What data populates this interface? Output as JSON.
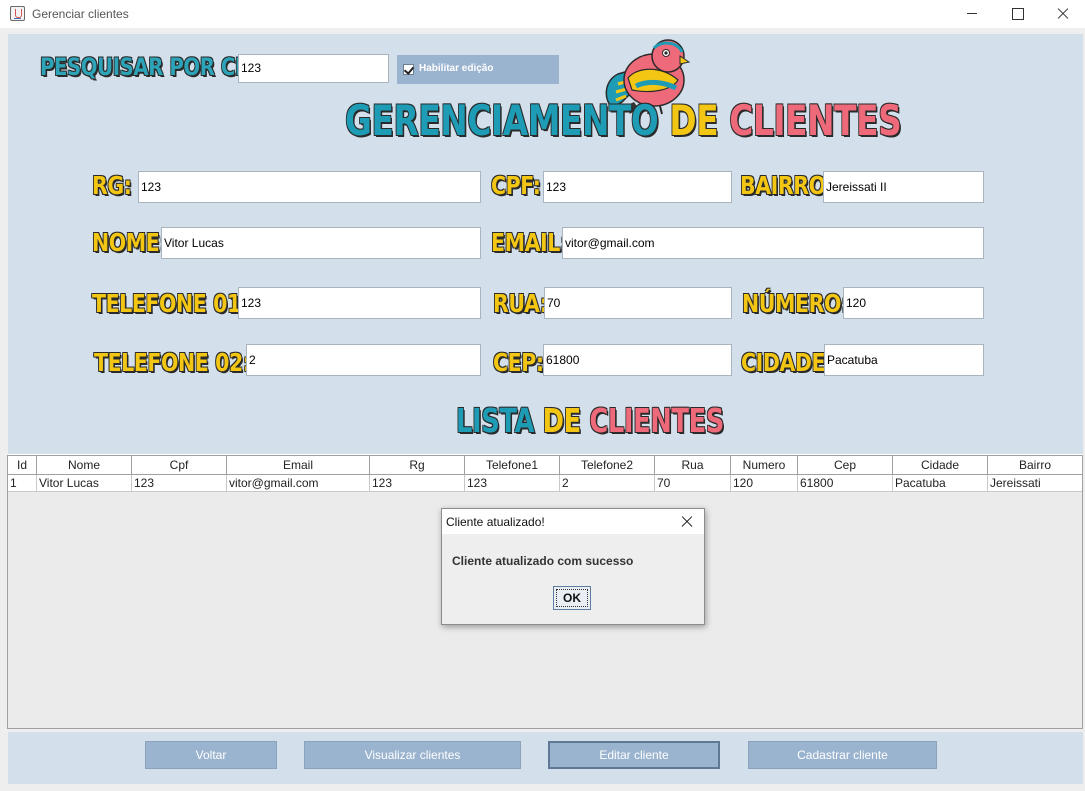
{
  "window": {
    "title": "Gerenciar clientes"
  },
  "search": {
    "label": "PESQUISAR POR CPF:",
    "value": "123",
    "edit_toggle_label": "Habilitar edição",
    "edit_toggle_checked": true
  },
  "header": {
    "title_part1": "GERENCIAMENTO ",
    "title_part2": "DE ",
    "title_part3": "CLIENTES"
  },
  "form": {
    "rg": {
      "label": "RG:",
      "value": "123"
    },
    "cpf": {
      "label": "CPF:",
      "value": "123"
    },
    "bairro": {
      "label": "BAIRRO:",
      "value": "Jereissati II"
    },
    "nome": {
      "label": "NOME:",
      "value": "Vitor Lucas"
    },
    "email": {
      "label": "EMAIL:",
      "value": "vitor@gmail.com"
    },
    "telefone1": {
      "label": "TELEFONE 01:",
      "value": "123"
    },
    "rua": {
      "label": "RUA:",
      "value": "70"
    },
    "numero": {
      "label": "NÚMERO:",
      "value": "120"
    },
    "telefone2": {
      "label": "TELEFONE 02:",
      "value": "2"
    },
    "cep": {
      "label": "CEP:",
      "value": "61800"
    },
    "cidade": {
      "label": "CIDADE:",
      "value": "Pacatuba"
    }
  },
  "list": {
    "title_part1": "LISTA ",
    "title_part2": "DE ",
    "title_part3": "CLIENTES"
  },
  "table": {
    "columns": [
      "Id",
      "Nome",
      "Cpf",
      "Email",
      "Rg",
      "Telefone1",
      "Telefone2",
      "Rua",
      "Numero",
      "Cep",
      "Cidade",
      "Bairro"
    ],
    "rows": [
      [
        "1",
        "Vitor Lucas",
        "123",
        "vitor@gmail.com",
        "123",
        "123",
        "2",
        "70",
        "120",
        "61800",
        "Pacatuba",
        "Jereissati"
      ]
    ]
  },
  "dialog": {
    "title": "Cliente atualizado!",
    "message": "Cliente atualizado com sucesso",
    "ok_label": "OK"
  },
  "buttons": {
    "voltar": "Voltar",
    "visualizar": "Visualizar clientes",
    "editar": "Editar cliente",
    "cadastrar": "Cadastrar cliente"
  },
  "colors": {
    "panel_bg": "#d3dfea",
    "button_bg": "#9ab3cf",
    "label_yellow": "#f3c614",
    "title_blue": "#1e9cb5",
    "title_pink": "#ee6a7a"
  },
  "icons": {
    "app": "java-cup-icon",
    "logo": "bird-logo"
  }
}
